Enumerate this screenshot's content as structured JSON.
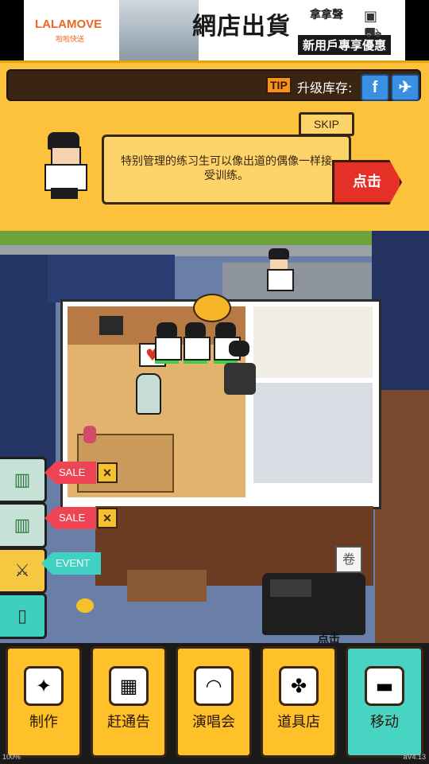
{
  "ad": {
    "brand": "LALAMOVE",
    "brand_sub": "啦啦快送",
    "headline": "網店出貨",
    "line1": "拿拿聲",
    "line2": "新用戶專享優惠",
    "icons": [
      "package-icon",
      "cart-icon",
      "cursor-icon"
    ]
  },
  "header": {
    "tip_badge": "TIP",
    "upgrade_label": "升级库存:",
    "social": [
      "facebook-icon",
      "twitter-icon"
    ]
  },
  "tutorial": {
    "skip_label": "SKIP",
    "message": "特别管理的练习生可以像出道的偶像一样接受训练。",
    "tap_label": "点击"
  },
  "scene": {
    "heart_icon": "♥",
    "sign_icon": "卷",
    "tap_hint": "点击"
  },
  "side": {
    "sale1": "SALE",
    "sale2": "SALE",
    "event": "EVENT"
  },
  "menu": [
    {
      "label": "制作",
      "icon": "✦",
      "active": false
    },
    {
      "label": "赶通告",
      "icon": "▦",
      "active": false
    },
    {
      "label": "演唱会",
      "icon": "◠",
      "active": false
    },
    {
      "label": "道具店",
      "icon": "✤",
      "active": false
    },
    {
      "label": "移动",
      "icon": "▬",
      "active": true
    }
  ],
  "footer": {
    "zoom": "100%",
    "version": "aV4.13"
  },
  "colors": {
    "panel": "#fdc23b",
    "tap_button": "#e53027",
    "sale_tag": "#ef4453",
    "event_tag": "#3fd2c2",
    "menu_button": "#ffc12a",
    "menu_active": "#47d4c3"
  }
}
